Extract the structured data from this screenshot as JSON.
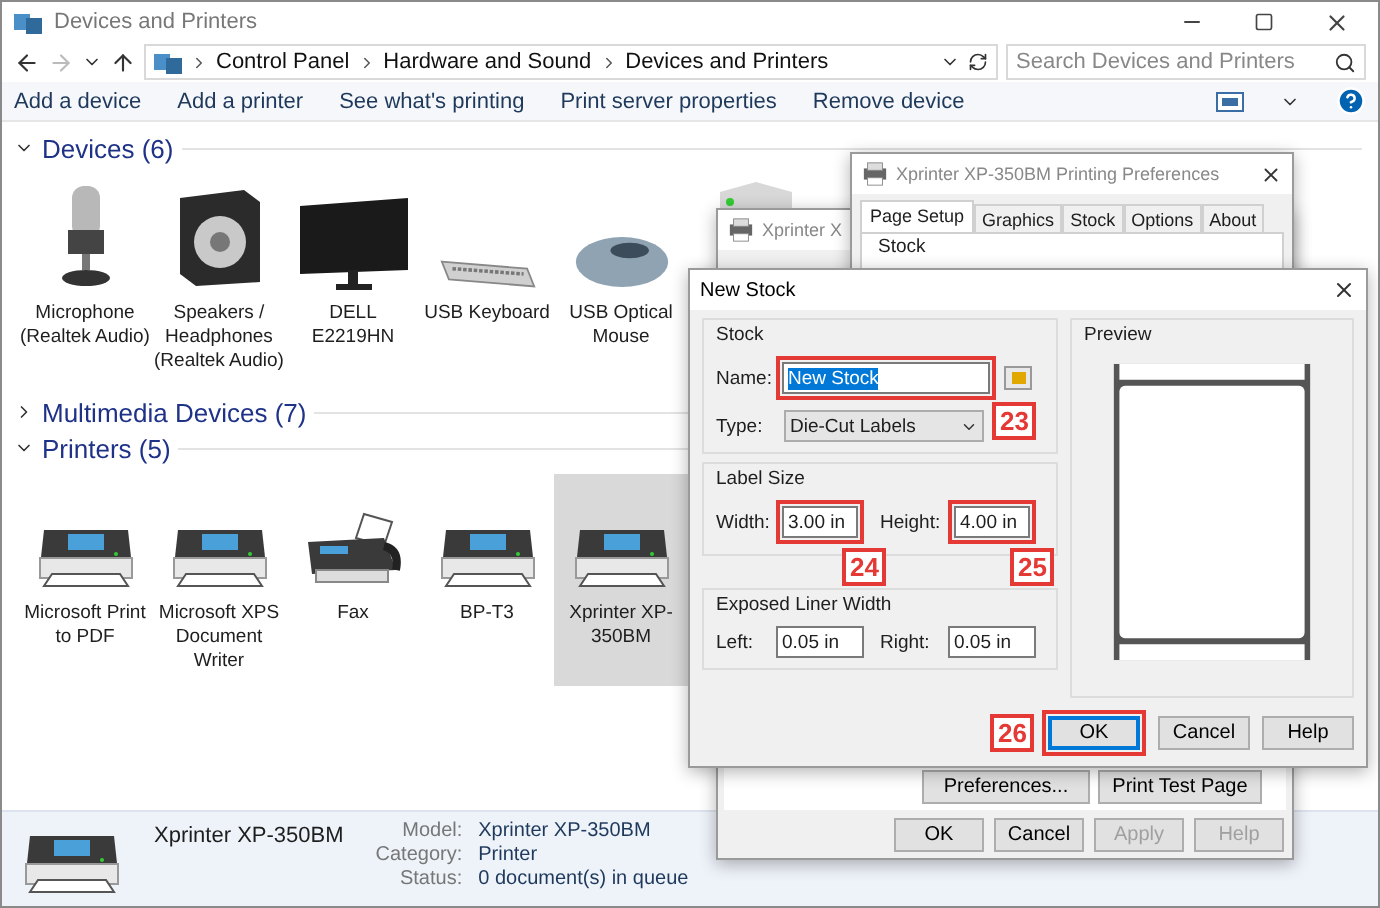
{
  "window": {
    "title": "Devices and Printers"
  },
  "address": {
    "breadcrumbs": [
      "Control Panel",
      "Hardware and Sound",
      "Devices and Printers"
    ],
    "search_placeholder": "Search Devices and Printers"
  },
  "toolbar": [
    "Add a device",
    "Add a printer",
    "See what's printing",
    "Print server properties",
    "Remove device"
  ],
  "groups": [
    {
      "title": "Devices (6)",
      "expanded": true,
      "items": [
        {
          "label": "Microphone (Realtek Audio)",
          "kind": "microphone",
          "selected": false
        },
        {
          "label": "Speakers / Headphones (Realtek Audio)",
          "kind": "speaker",
          "selected": false
        },
        {
          "label": "DELL E2219HN",
          "kind": "monitor",
          "selected": false
        },
        {
          "label": "USB Keyboard",
          "kind": "keyboard",
          "selected": false
        },
        {
          "label": "USB Optical Mouse",
          "kind": "mouse",
          "selected": false
        },
        {
          "kind": "server",
          "selected": false
        }
      ]
    },
    {
      "title": "Multimedia Devices (7)",
      "expanded": false
    },
    {
      "title": "Printers (5)",
      "expanded": true,
      "items": [
        {
          "label": "Microsoft Print to PDF",
          "kind": "printer",
          "selected": false
        },
        {
          "label": "Microsoft XPS Document Writer",
          "kind": "printer",
          "selected": false
        },
        {
          "label": "Fax",
          "kind": "fax",
          "selected": false
        },
        {
          "label": "BP-T3",
          "kind": "printer",
          "selected": false
        },
        {
          "label": "Xprinter XP-350BM",
          "kind": "printer",
          "selected": true
        }
      ]
    }
  ],
  "details": {
    "name": "Xprinter XP-350BM",
    "fields": [
      {
        "label": "Model:",
        "value": "Xprinter XP-350BM"
      },
      {
        "label": "Category:",
        "value": "Printer"
      },
      {
        "label": "Status:",
        "value": "0 document(s) in queue"
      }
    ]
  },
  "properties_window": {
    "title": "Xprinter X",
    "buttons": [
      {
        "label": "Preferences...",
        "disabled": false
      },
      {
        "label": "Print Test Page",
        "disabled": false
      }
    ],
    "footer_buttons": [
      {
        "label": "OK",
        "disabled": false
      },
      {
        "label": "Cancel",
        "disabled": false
      },
      {
        "label": "Apply",
        "disabled": true
      },
      {
        "label": "Help",
        "disabled": true
      }
    ]
  },
  "preferences_window": {
    "title": "Xprinter XP-350BM Printing Preferences",
    "tabs": [
      {
        "label": "Page Setup",
        "selected": true
      },
      {
        "label": "Graphics",
        "selected": false
      },
      {
        "label": "Stock",
        "selected": false
      },
      {
        "label": "Options",
        "selected": false
      },
      {
        "label": "About",
        "selected": false
      }
    ],
    "group": "Stock"
  },
  "new_stock_dialog": {
    "title": "New Stock",
    "stock_group": "Stock",
    "name_label": "Name:",
    "name_value": "New Stock",
    "name_text_selected": true,
    "type_label": "Type:",
    "type_value": "Die-Cut Labels",
    "size_group": "Label Size",
    "width_label": "Width:",
    "width_value": "3.00 in",
    "height_label": "Height:",
    "height_value": "4.00 in",
    "liner_group": "Exposed Liner Width",
    "left_label": "Left:",
    "left_value": "0.05 in",
    "right_label": "Right:",
    "right_value": "0.05 in",
    "preview_group": "Preview",
    "buttons": [
      {
        "label": "OK",
        "default": true
      },
      {
        "label": "Cancel",
        "default": false
      },
      {
        "label": "Help",
        "default": false
      }
    ]
  },
  "callouts": [
    "23",
    "24",
    "25",
    "26"
  ]
}
